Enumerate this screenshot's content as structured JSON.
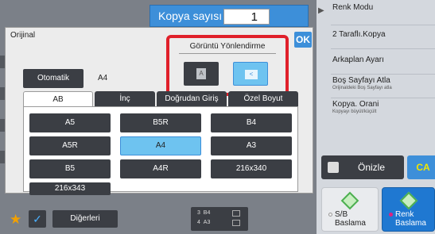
{
  "copy_count": {
    "label": "Kopya sayısı",
    "value": "1"
  },
  "right_panel": {
    "items": [
      {
        "label": "Renk Modu"
      },
      {
        "label": "2 Taraflı.Kopya"
      },
      {
        "label": "Arkaplan Ayarı"
      },
      {
        "label": "Boş Sayfayı Atla",
        "sub": "Orijinaldeki Boş Sayfayı atla"
      },
      {
        "label": "Kopya. Orani",
        "sub": "Kopyayı büyüt/küçült"
      }
    ],
    "preview_label": "Önizle",
    "ca_label": "CA",
    "start_bw_label": "S/B\nBaslama",
    "start_color_label": "Renk\nBaslama"
  },
  "dialog": {
    "title": "Orijinal",
    "ok_label": "OK",
    "orientation": {
      "label": "Görüntü Yönlendirme",
      "portrait_glyph": "A",
      "landscape_glyph": "<"
    },
    "auto_label": "Otomatik",
    "auto_value": "A4",
    "tabs": [
      "AB",
      "İnç",
      "Doğrudan Giriş",
      "Özel Boyut"
    ],
    "sizes": [
      "A5",
      "B5R",
      "B4",
      "A5R",
      "A4",
      "A3",
      "B5",
      "A4R",
      "216x340",
      "216x343"
    ],
    "selected_size": "A4"
  },
  "bottom": {
    "others_label": "Diğerleri",
    "tray_rows": [
      {
        "num": "3",
        "size": "B4"
      },
      {
        "num": "4",
        "size": "A3"
      }
    ]
  },
  "colors": {
    "accent": "#3d8fd9",
    "selected": "#6ec3f0",
    "highlight": "#e0202a",
    "dark_button": "#3b3e44"
  }
}
